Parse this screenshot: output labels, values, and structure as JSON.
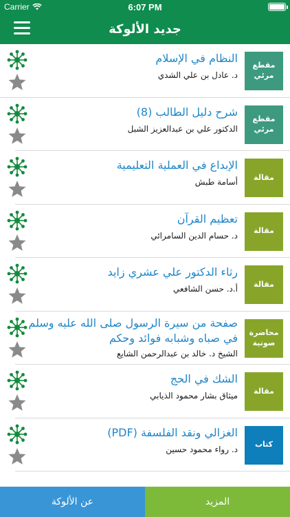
{
  "status_bar": {
    "carrier": "Carrier",
    "time": "6:07 PM"
  },
  "navbar": {
    "title": "جديد الألوكة",
    "menu_icon": "hamburger-menu-icon"
  },
  "colors": {
    "brand_green": "#0f8c4e",
    "title_blue": "#1e86c9",
    "badge_teal": "#3d9a7f",
    "badge_olive": "#88a52a",
    "badge_blue": "#0e7fba",
    "tab_about": "#3a95d6",
    "tab_more": "#7dba3a"
  },
  "items": [
    {
      "title": "النظام في الإسلام",
      "author": "د. عادل بن علي الشدي",
      "type": "مقطع مرئي",
      "badge_color": "teal"
    },
    {
      "title": "شرح دليل الطالب (8)",
      "author": "الدكتور علي بن عبدالعزيز الشبل",
      "type": "مقطع مرئي",
      "badge_color": "teal"
    },
    {
      "title": "الإبداع في العملية التعليمية",
      "author": "أسامة طبش",
      "type": "مقالة",
      "badge_color": "olive"
    },
    {
      "title": "تعظيم القرآن",
      "author": "د. حسام الدين السامرائي",
      "type": "مقالة",
      "badge_color": "olive"
    },
    {
      "title": "رثاء الدكتور علي عشري زايد",
      "author": "أ.د. حسن الشافعي",
      "type": "مقالة",
      "badge_color": "olive"
    },
    {
      "title": "صفحة من سيرة الرسول صلى الله عليه وسلم في صباه وشبابه فوائد وحكم",
      "author": "الشيخ د. خالد بن عبدالرحمن الشايع",
      "type": "محاضرة صوتية",
      "badge_color": "olive"
    },
    {
      "title": "الشك في الحج",
      "author": "ميثاق بشار محمود الذيابي",
      "type": "مقالة",
      "badge_color": "olive"
    },
    {
      "title": "الغزالي ونقد الفلسفة (PDF)",
      "author": "د. رواء محمود حسين",
      "type": "كتاب",
      "badge_color": "blue"
    }
  ],
  "tabs": {
    "about": "عن الألوكة",
    "more": "المزيد"
  }
}
